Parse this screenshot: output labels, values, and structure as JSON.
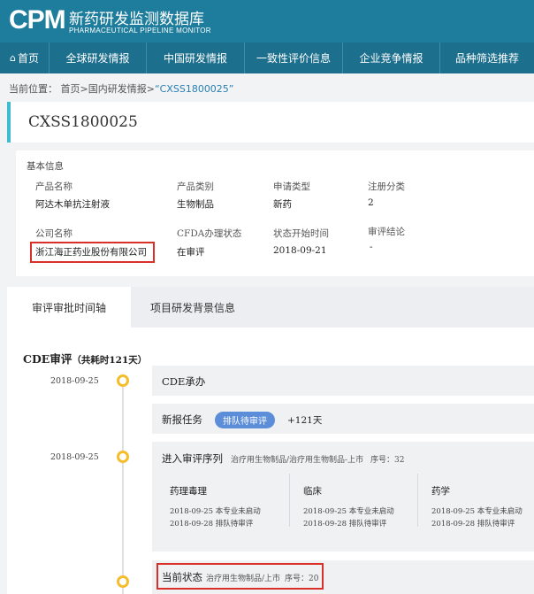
{
  "header": {
    "logo_mark": "CPM",
    "logo_cn": "新药研发监测数据库",
    "logo_en": "PHARMACEUTICAL PIPELINE MONITOR"
  },
  "nav": {
    "items": [
      {
        "label": "首页",
        "icon": "home-icon"
      },
      {
        "label": "全球研发情报"
      },
      {
        "label": "中国研发情报"
      },
      {
        "label": "一致性评价信息"
      },
      {
        "label": "企业竞争情报"
      },
      {
        "label": "品种筛选推荐"
      }
    ]
  },
  "breadcrumb": {
    "prefix": "当前位置： 首页>国内研发情报>",
    "current": "“CXSS1800025”"
  },
  "record": {
    "title": "CXSS1800025"
  },
  "basic_info": {
    "heading": "基本信息",
    "fields": [
      {
        "label": "产品名称",
        "value": "阿达木单抗注射液"
      },
      {
        "label": "产品类别",
        "value": "生物制品"
      },
      {
        "label": "申请类型",
        "value": "新药"
      },
      {
        "label": "注册分类",
        "value": "2"
      },
      {
        "label": "公司名称",
        "value": "浙江海正药业股份有限公司"
      },
      {
        "label": "CFDA办理状态",
        "value": "在审评"
      },
      {
        "label": "状态开始时间",
        "value": "2018-09-21"
      },
      {
        "label": "审评结论",
        "value": "-"
      }
    ]
  },
  "tabs": [
    {
      "label": "审评审批时间轴",
      "active": true
    },
    {
      "label": "项目研发背景信息",
      "active": false
    }
  ],
  "timeline": {
    "heading": "CDE审评",
    "heading_sub": "（共耗时121天）",
    "events": {
      "e1": {
        "date": "2018-09-25",
        "text": "CDE承办"
      },
      "e2": {
        "text": "新报任务",
        "pill": "排队待审评",
        "extra": "+121天"
      },
      "e3": {
        "date": "2018-09-25",
        "text": "进入审评序列",
        "detail": "治疗用生物制品/治疗用生物制品-上市",
        "seq": "序号：32",
        "columns": [
          {
            "title": "药理毒理",
            "lines": [
              "2018-09-25  本专业未启动",
              "2018-09-28  排队待审评"
            ]
          },
          {
            "title": "临床",
            "lines": [
              "2018-09-25  本专业未启动",
              "2018-09-28  排队待审评"
            ]
          },
          {
            "title": "药学",
            "lines": [
              "2018-09-25  本专业未启动",
              "2018-09-28  排队待审评"
            ]
          }
        ]
      },
      "e4": {
        "text": "当前状态",
        "detail": "治疗用生物制品/上市",
        "seq": "序号：20"
      }
    }
  },
  "colors": {
    "header_bg": "#1e7d9c",
    "nav_bg": "#1d6f8e",
    "accent": "#3fbcd0",
    "highlight": "#d9302a",
    "timeline_dot": "#f3bd2c",
    "pill": "#5b8dd9"
  }
}
